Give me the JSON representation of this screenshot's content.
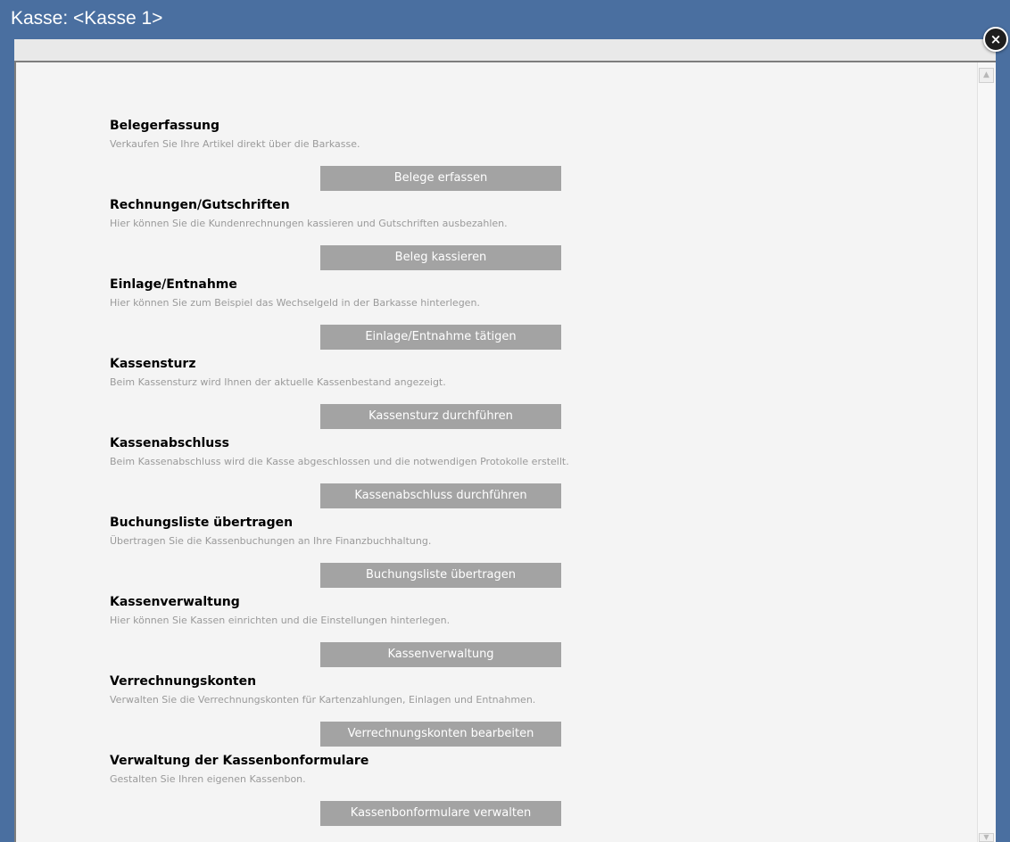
{
  "window": {
    "title": "Kasse: <Kasse 1>",
    "close_icon": "×"
  },
  "scrollbar": {
    "up_arrow": "▲",
    "down_arrow": "▼"
  },
  "sections": [
    {
      "title": "Belegerfassung",
      "description": "Verkaufen Sie Ihre Artikel direkt über die Barkasse.",
      "button": "Belege erfassen"
    },
    {
      "title": "Rechnungen/Gutschriften",
      "description": "Hier können Sie die Kundenrechnungen kassieren und Gutschriften ausbezahlen.",
      "button": "Beleg kassieren"
    },
    {
      "title": "Einlage/Entnahme",
      "description": "Hier können Sie zum Beispiel das Wechselgeld in der Barkasse hinterlegen.",
      "button": "Einlage/Entnahme tätigen"
    },
    {
      "title": "Kassensturz",
      "description": "Beim Kassensturz wird Ihnen der aktuelle Kassenbestand angezeigt.",
      "button": "Kassensturz durchführen"
    },
    {
      "title": "Kassenabschluss",
      "description": "Beim Kassenabschluss wird die Kasse abgeschlossen und die notwendigen Protokolle erstellt.",
      "button": "Kassenabschluss durchführen"
    },
    {
      "title": "Buchungsliste übertragen",
      "description": "Übertragen Sie die Kassenbuchungen an Ihre Finanzbuchhaltung.",
      "button": "Buchungsliste übertragen"
    },
    {
      "title": "Kassenverwaltung",
      "description": "Hier können Sie Kassen einrichten und die Einstellungen hinterlegen.",
      "button": "Kassenverwaltung"
    },
    {
      "title": "Verrechnungskonten",
      "description": "Verwalten Sie die Verrechnungskonten für Kartenzahlungen, Einlagen und Entnahmen.",
      "button": "Verrechnungskonten bearbeiten"
    },
    {
      "title": "Verwaltung der Kassenbonformulare",
      "description": "Gestalten Sie Ihren eigenen Kassenbon.",
      "button": "Kassenbonformulare verwalten"
    }
  ]
}
